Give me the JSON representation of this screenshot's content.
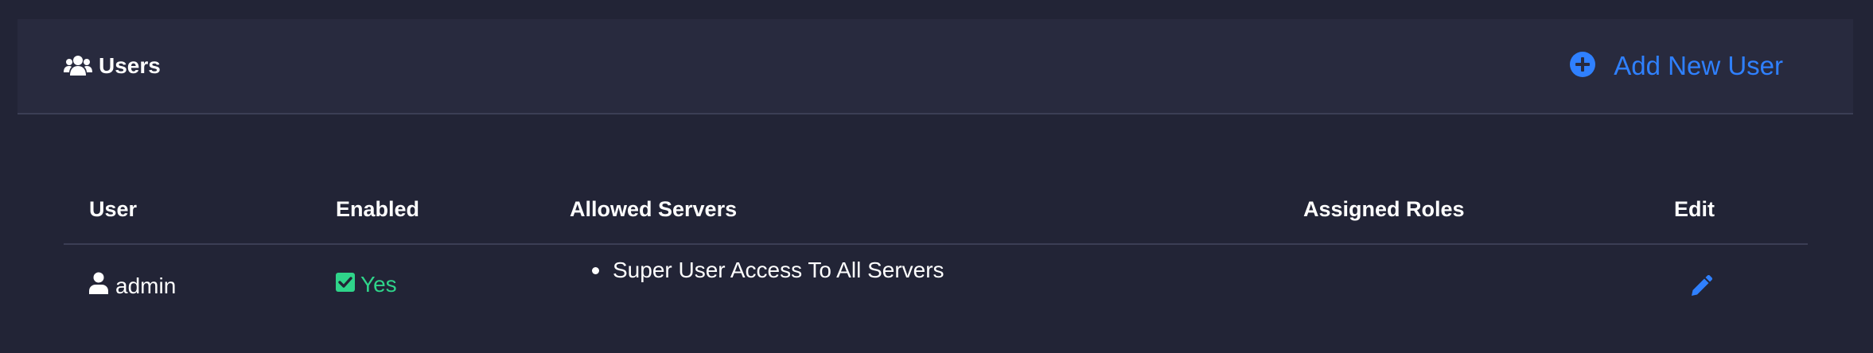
{
  "header": {
    "title": "Users",
    "title_icon": "users-icon",
    "add_button_label": "Add New User",
    "add_button_icon": "plus-circle-icon"
  },
  "table": {
    "columns": [
      "User",
      "Enabled",
      "Allowed Servers",
      "Assigned Roles",
      "Edit"
    ],
    "rows": [
      {
        "user": "admin",
        "user_icon": "user-icon",
        "enabled": "Yes",
        "enabled_icon": "check-square-icon",
        "allowed_servers": [
          "Super User Access To All Servers"
        ],
        "assigned_roles": "",
        "edit_icon": "pencil-icon"
      }
    ]
  },
  "colors": {
    "background": "#222436",
    "header_background": "#282a3e",
    "accent": "#2f80ff",
    "success": "#2fd48a",
    "divider": "#3b3e55"
  }
}
